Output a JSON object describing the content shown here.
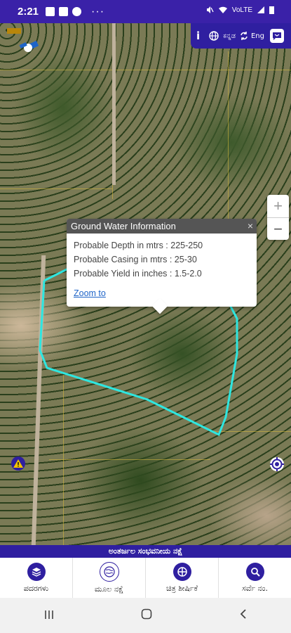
{
  "status_bar": {
    "time": "2:21",
    "more": "···",
    "signal": "VoLTE"
  },
  "toolbar": {
    "info": "i",
    "language_kn": "ಕನ್ನಡ",
    "language_en": "Eng"
  },
  "zoom": {
    "in": "+",
    "out": "−"
  },
  "popup": {
    "title": "Ground Water Information",
    "close": "×",
    "lines": [
      "Probable Depth in mtrs : 225-250",
      "Probable Casing in mtrs : 25-30",
      "Probable Yield in inches : 1.5-2.0"
    ],
    "zoom_link": "Zoom to"
  },
  "map_title": "ಅಂತರ್ಜಲ ಸಂಭವನೀಯ ನಕ್ಷೆ",
  "bottom_nav": [
    {
      "label": "ಪದರಗಳು",
      "icon": "layers-icon"
    },
    {
      "label": "ಮೂಲ ನಕ್ಷೆ",
      "icon": "basemap-icon"
    },
    {
      "label": "ಚಿತ್ರ ಶೀರ್ಷಿಕೆ",
      "icon": "legend-icon"
    },
    {
      "label": "ಸರ್ವೆ ನಂ.",
      "icon": "search-icon"
    }
  ],
  "colors": {
    "primary": "#2f1fa0",
    "boundary": "#2ee6e0"
  }
}
